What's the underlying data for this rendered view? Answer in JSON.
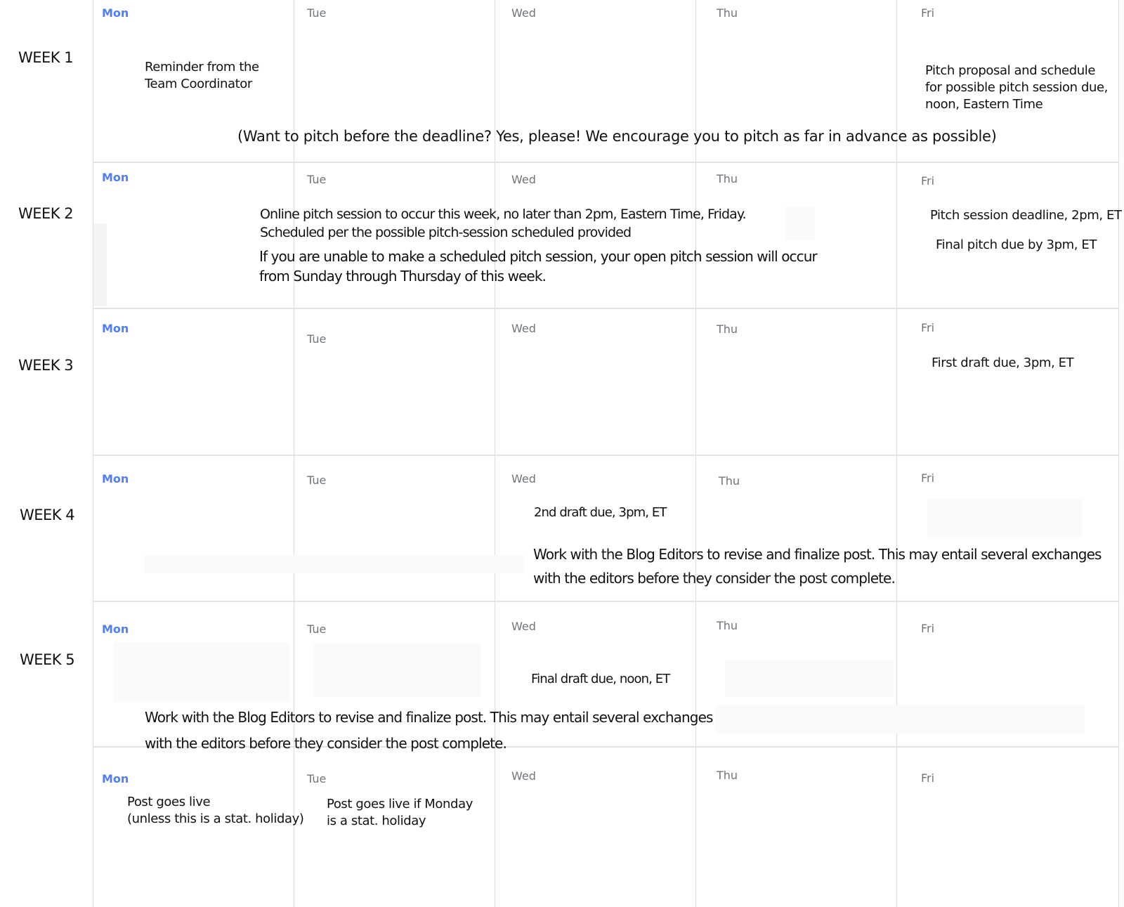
{
  "calendar": {
    "days": [
      "Mon",
      "Tue",
      "Wed",
      "Thu",
      "Fri"
    ],
    "weeks": [
      {
        "label": "WEEK 1",
        "events": {
          "mon": [
            "Reminder from the",
            "Team Coordinator"
          ],
          "fri": [
            "Pitch proposal and schedule",
            "for possible pitch session due,",
            "noon, Eastern Time"
          ],
          "banner": "(Want to pitch before the deadline?  Yes, please! We encourage you  to pitch as far in advance as possible)"
        }
      },
      {
        "label": "WEEK 2",
        "events": {
          "span1": [
            "Online pitch session to occur this week, no later than 2pm, Eastern Time, Friday.",
            "Scheduled per the possible pitch-session scheduled provided"
          ],
          "span2": [
            "If you are unable to make a scheduled pitch session, your open pitch session will occur",
            "from Sunday through Thursday of this week."
          ],
          "fri1": "Pitch session deadline, 2pm, ET",
          "fri2": "Final pitch due by 3pm, ET"
        }
      },
      {
        "label": "WEEK 3",
        "events": {
          "fri": "First draft due, 3pm, ET"
        }
      },
      {
        "label": "WEEK 4",
        "events": {
          "wed": "2nd draft due, 3pm, ET",
          "span": [
            "Work with the Blog Editors to revise and finalize post. This may entail several exchanges",
            "with the editors before they consider the post complete."
          ]
        }
      },
      {
        "label": "WEEK 5",
        "events": {
          "wed": "Final draft due, noon, ET",
          "span": [
            "Work with the Blog Editors to revise and finalize post. This may entail several exchanges",
            "with the editors before they consider the post complete."
          ]
        }
      },
      {
        "label": "",
        "events": {
          "mon": [
            "Post goes live",
            "(unless this is a stat. holiday)"
          ],
          "tue": [
            "Post goes live if Monday",
            "is a stat. holiday"
          ]
        }
      }
    ]
  }
}
